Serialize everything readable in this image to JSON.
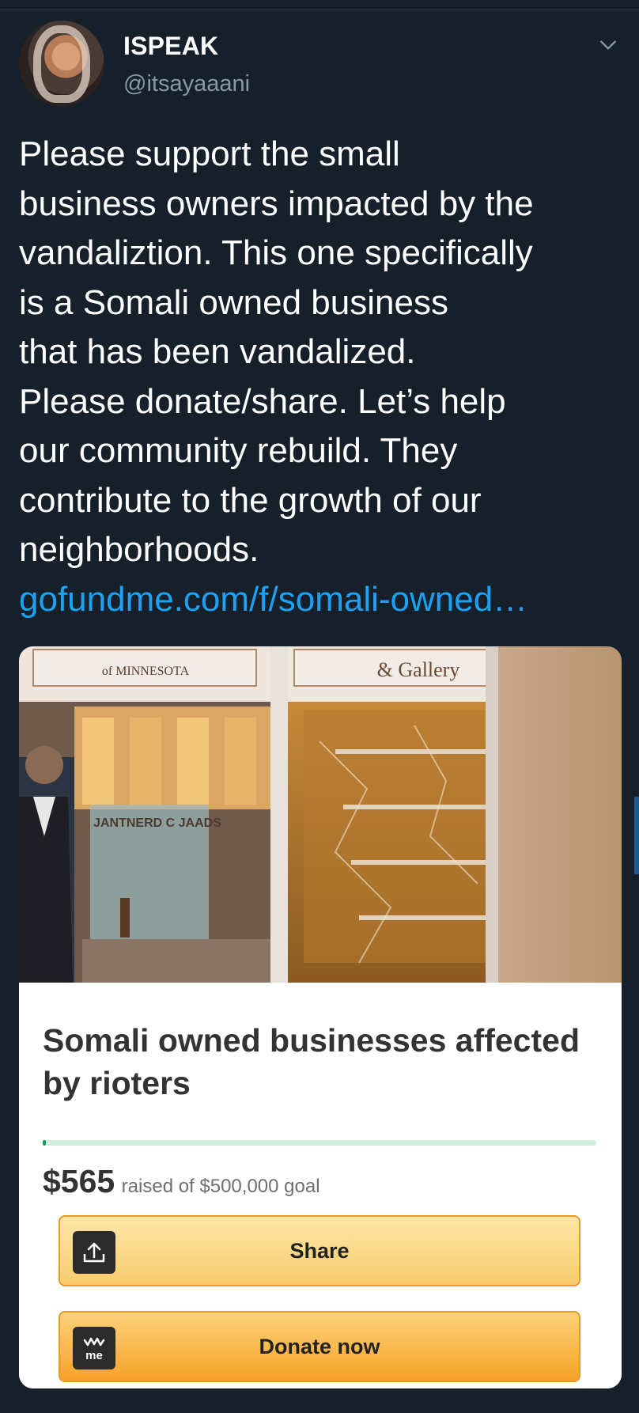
{
  "tweet": {
    "display_name": "ISPEAK",
    "handle": "@itsayaaani",
    "text": "Please support the small\nbusiness owners impacted by the\nvandaliztion. This one specifically\nis a Somali owned business\nthat has been vandalized.\nPlease donate/share. Let’s help\nour community rebuild. They\ncontribute to the growth of our\nneighborhoods.",
    "link": "gofundme.com/f/somali-owned…"
  },
  "photo": {
    "sign_left": "of MINNESOTA",
    "sign_right": "& Gallery",
    "window_text": "JANTNERD C JAADS"
  },
  "card": {
    "title": "Somali owned businesses affected by rioters",
    "raised_amount": "$565",
    "raised_text": "raised of $500,000 goal",
    "progress_fraction": 0.00113,
    "share_label": "Share",
    "donate_label": "Donate now",
    "donate_icon_text": "me"
  },
  "icons": [
    "avatar",
    "chevron-down-icon",
    "share-icon",
    "gofundme-logo-icon"
  ],
  "colors": {
    "background": "#15202b",
    "link": "#1da1f2",
    "muted": "#8899a6",
    "progress": "#02a95c",
    "button_accent": "#f6a127"
  }
}
